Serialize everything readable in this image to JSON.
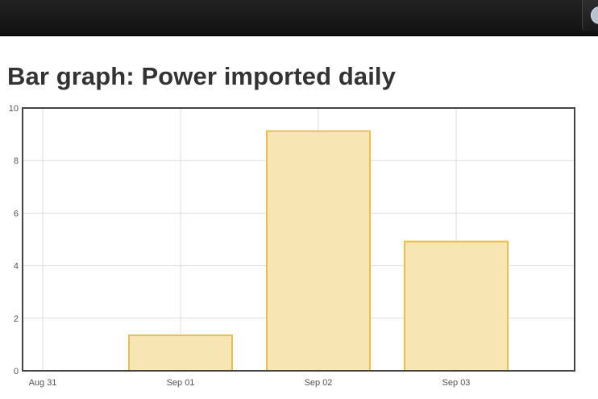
{
  "page": {
    "title": "Bar graph: Power imported daily"
  },
  "topbar": {
    "icon": "toolbar-round-icon"
  },
  "chart_data": {
    "type": "bar",
    "title": "Bar graph: Power imported daily",
    "categories": [
      "Sep 01",
      "Sep 02",
      "Sep 03"
    ],
    "values": [
      1.35,
      9.12,
      4.92
    ],
    "x_ticks": [
      "Aug 31",
      "Sep 01",
      "Sep 02",
      "Sep 03"
    ],
    "y_ticks": [
      0,
      2,
      4,
      6,
      8,
      10
    ],
    "ylim": [
      0,
      10
    ],
    "xlabel": "",
    "ylabel": "",
    "grid": true,
    "colors": {
      "bar_fill": "#f7e4b0",
      "bar_stroke": "#e8c04b",
      "grid": "#dddddd",
      "border": "#444444"
    }
  }
}
